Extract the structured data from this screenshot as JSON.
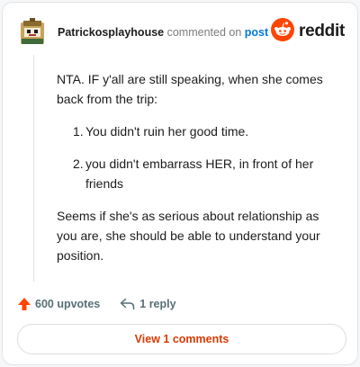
{
  "comment": {
    "username": "Patrickosplayhouse",
    "action_text": "commented on",
    "post_link": "post",
    "paragraph_1": "NTA. IF y'all are still speaking, when she comes back from the trip:",
    "list": [
      {
        "number": "1.",
        "text": "You didn't ruin her good time."
      },
      {
        "number": "2.",
        "text": "you didn't embarrass HER, in front of her friends"
      }
    ],
    "paragraph_2": "Seems if she's as serious about relationship as you are, she should be able to understand your position."
  },
  "brand": {
    "wordmark": "reddit",
    "accent_color": "#ff4500"
  },
  "actions": {
    "upvotes": "600 upvotes",
    "replies": "1 reply",
    "upvote_icon": "upvote-arrow-icon",
    "reply_icon": "reply-icon"
  },
  "view_button": {
    "label": "View 1 comments",
    "color": "#d93a00"
  }
}
